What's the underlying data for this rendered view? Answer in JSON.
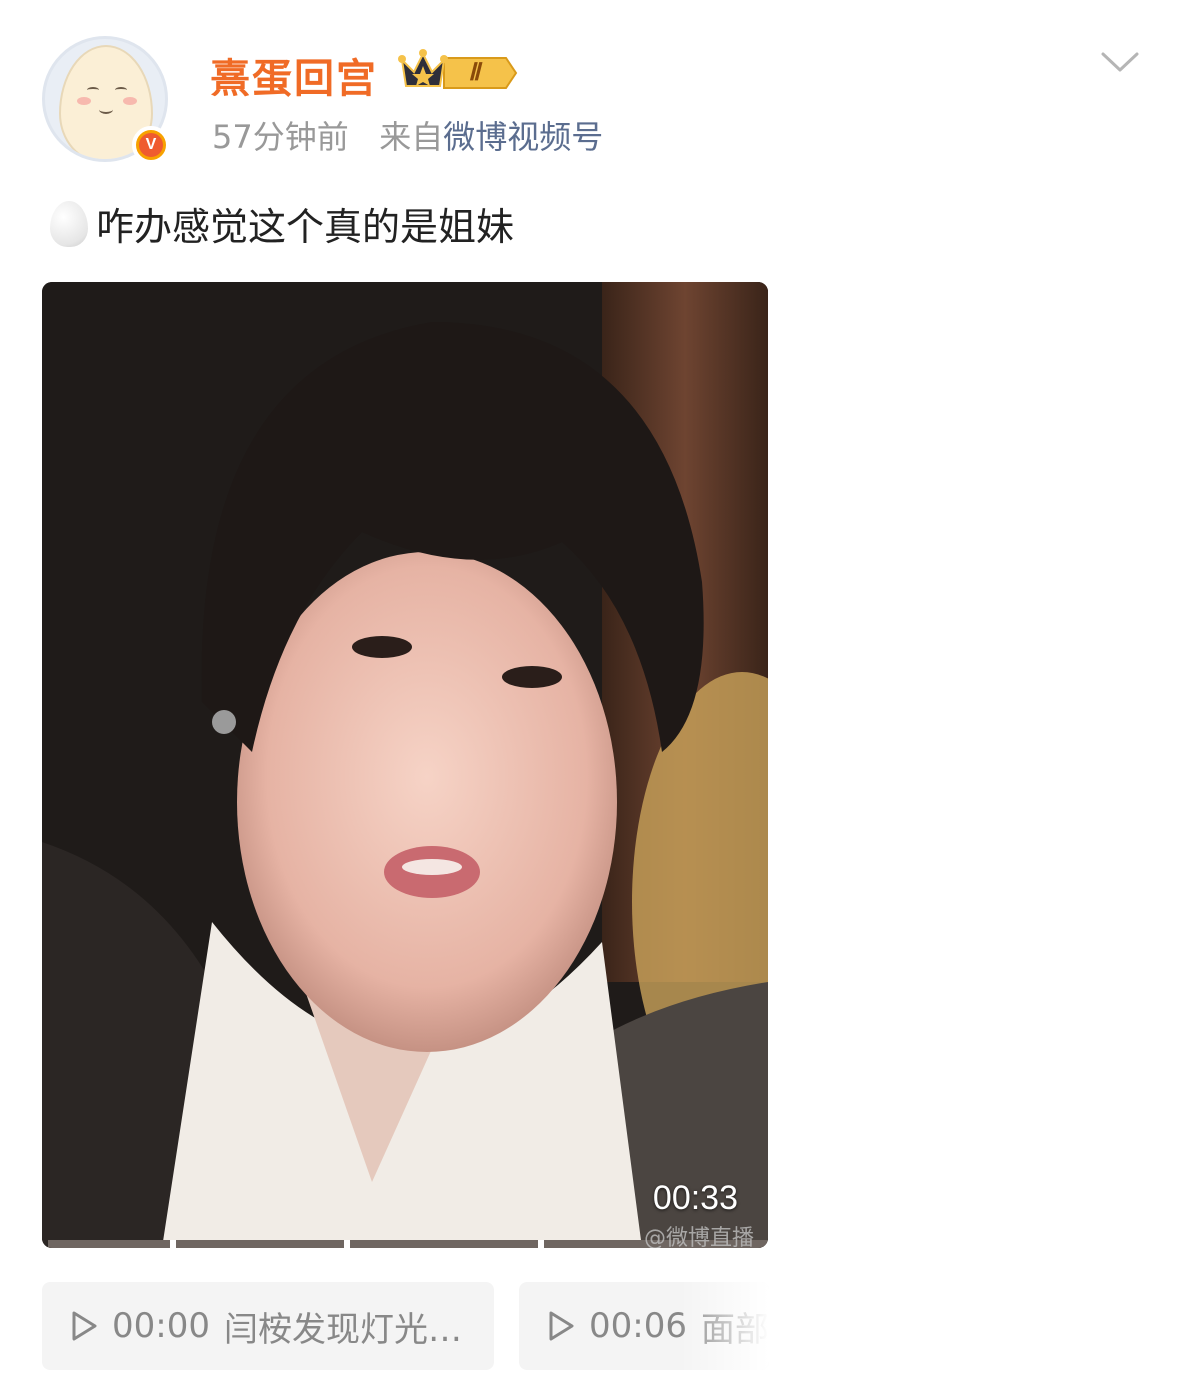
{
  "header": {
    "username": "熹蛋回宫",
    "member_level": "Ⅱ",
    "timestamp": "57分钟前",
    "source_prefix": "来自",
    "source_name": "微博视频号",
    "verified_mark": "V"
  },
  "post": {
    "text": "咋办感觉这个真的是姐妹"
  },
  "video": {
    "duration": "00:33",
    "watermark": "@微博直播"
  },
  "chapters": [
    {
      "time": "00:00",
      "title": "闫桉发现灯光…"
    },
    {
      "time": "00:06",
      "title": "面部"
    }
  ],
  "icons": {
    "dropdown": "chevron-down-icon",
    "crown": "crown-icon",
    "play": "play-icon",
    "emoji": "egg-emoji-icon"
  },
  "colors": {
    "username": "#f06b26",
    "meta": "#999999",
    "source_link": "#5b6d8f",
    "verified": "#f7a200"
  }
}
